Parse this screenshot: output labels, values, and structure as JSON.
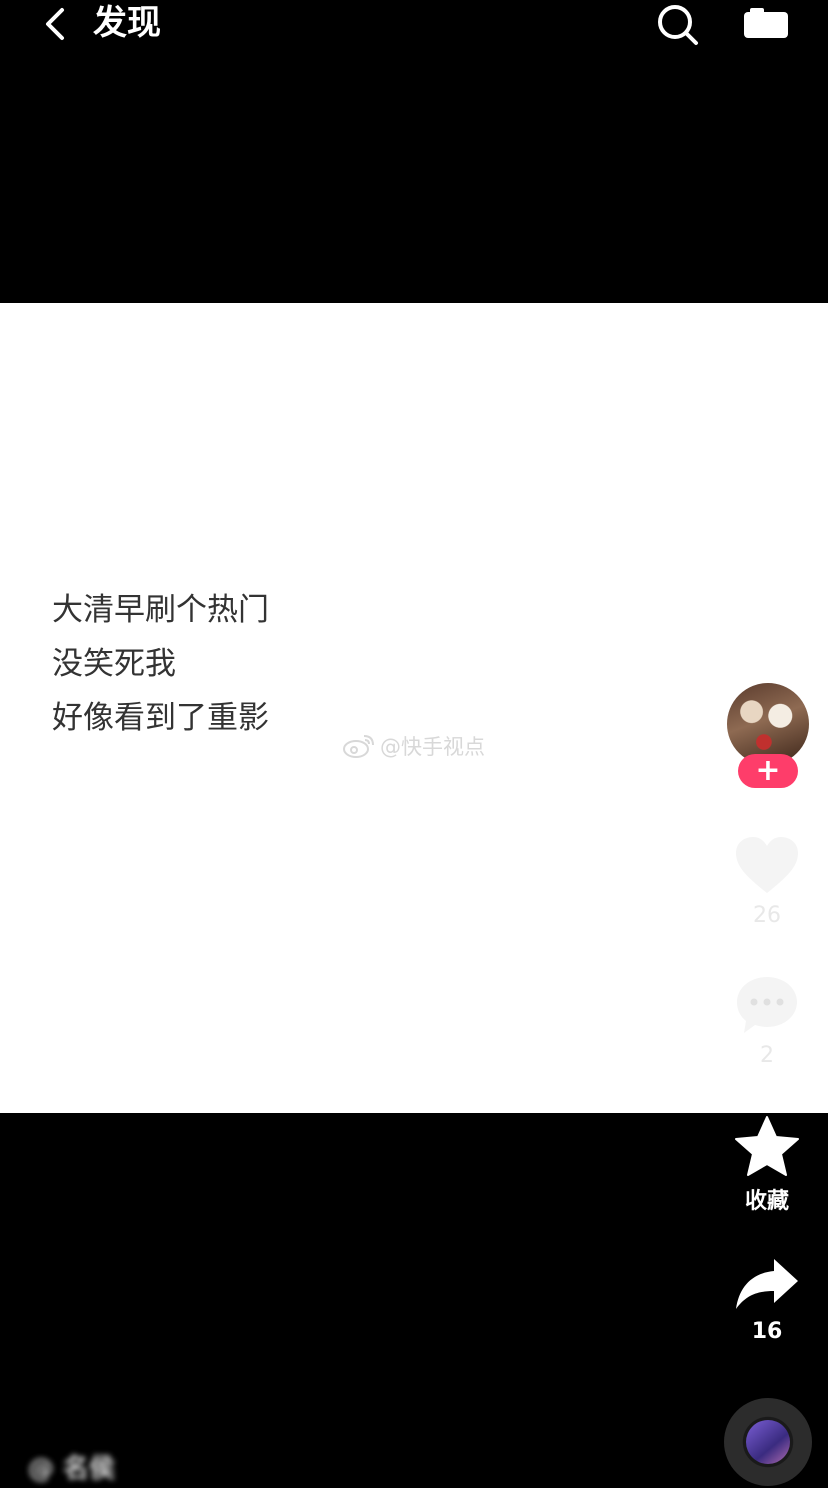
{
  "header": {
    "title": "发现",
    "back_icon": "chevron-left-icon",
    "search_icon": "search-icon",
    "camera_icon": "camera-icon"
  },
  "post": {
    "caption_lines": [
      "大清早刷个热门",
      "没笑死我",
      "好像看到了重影"
    ],
    "watermark": "@快手视点"
  },
  "sidebar": {
    "follow_label": "+",
    "like_count": "26",
    "comment_count": "2",
    "favorite_label": "收藏",
    "share_count": "16"
  },
  "footer": {
    "author_blurred": "@ 名侯"
  },
  "colors": {
    "background": "#000000",
    "video": "#ffffff",
    "follow_button": "#fe3d6a"
  }
}
